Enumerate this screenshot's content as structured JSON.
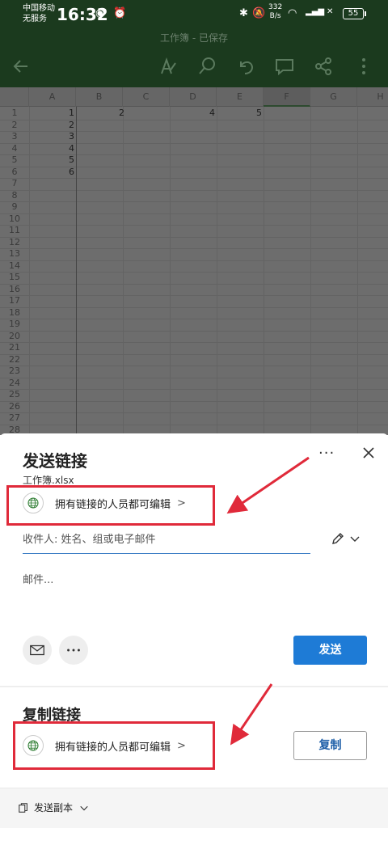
{
  "status_bar": {
    "carrier_line1": "中国移动",
    "carrier_line2": "无服务",
    "time": "16:32",
    "net_speed_value": "332",
    "net_speed_unit": "B/s",
    "battery": "55"
  },
  "app_header": {
    "doc_title": "工作簿 - 已保存"
  },
  "sheet": {
    "columns": [
      "A",
      "B",
      "C",
      "D",
      "E",
      "F",
      "G",
      "H"
    ],
    "selected_column": "F",
    "rows": [
      "1",
      "2",
      "3",
      "4",
      "5",
      "6",
      "7",
      "8",
      "9",
      "10",
      "11",
      "12",
      "13",
      "14",
      "15",
      "16",
      "17",
      "18",
      "19",
      "20",
      "21",
      "22",
      "23",
      "24",
      "25",
      "26",
      "27",
      "28"
    ],
    "column_a_values": [
      "1",
      "2",
      "3",
      "4",
      "5",
      "6"
    ],
    "row1_b": "2",
    "row1_d": "4",
    "row1_e": "5"
  },
  "send_link": {
    "title": "发送链接",
    "file_name": "工作簿.xlsx",
    "more_label": "···",
    "permission_text": "拥有链接的人员都可编辑",
    "recipients_placeholder": "收件人: 姓名、组或电子邮件",
    "message_placeholder": "邮件...",
    "send_button": "发送"
  },
  "copy_link": {
    "title": "复制链接",
    "permission_text": "拥有链接的人员都可编辑",
    "copy_button": "复制"
  },
  "footer": {
    "send_copy_label": "发送副本"
  },
  "colors": {
    "header_green": "#1b3a1e",
    "primary_blue": "#1e7bd6",
    "highlight_red": "#e02a3a",
    "globe_green": "#2e7d32"
  }
}
